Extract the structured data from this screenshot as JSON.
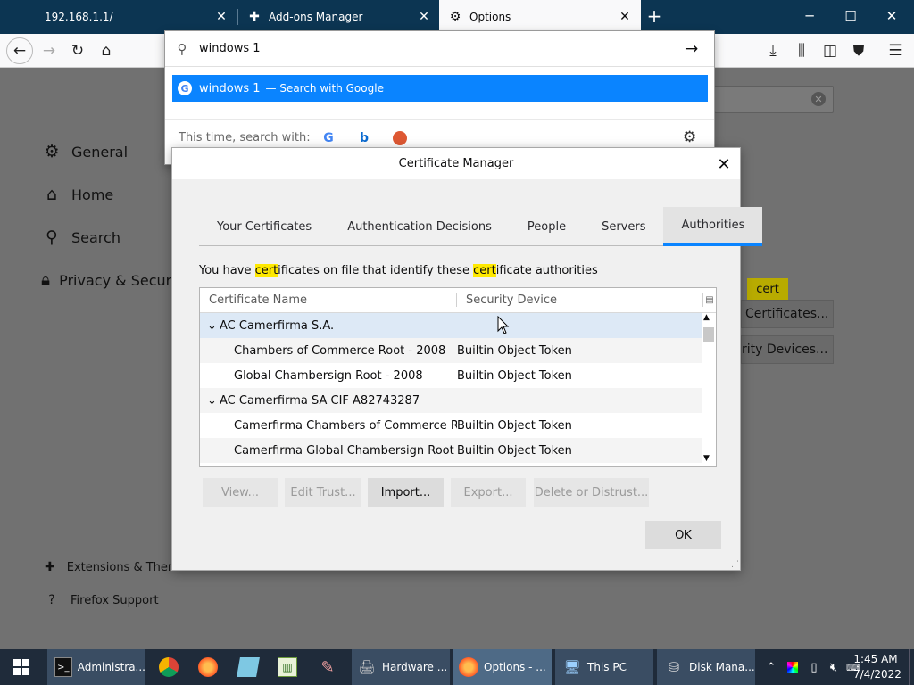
{
  "browser": {
    "tabs": [
      {
        "title": "192.168.1.1/",
        "icon": "page-icon"
      },
      {
        "title": "Add-ons Manager",
        "icon": "puzzle-icon"
      },
      {
        "title": "Options",
        "icon": "gear-icon",
        "active": true
      }
    ],
    "new_tab_glyph": "+",
    "window_controls": {
      "minimize": "─",
      "maximize": "☐",
      "close": "✕"
    }
  },
  "urlbar": {
    "value": "windows 1",
    "suggestion_text": "windows 1",
    "suggestion_action": "— Search with Google",
    "one_off_label": "This time, search with:",
    "engines": [
      "google-icon",
      "bing-icon",
      "duckduckgo-icon"
    ]
  },
  "prefs": {
    "categories": [
      {
        "label": "General",
        "icon": "gear-icon"
      },
      {
        "label": "Home",
        "icon": "home-icon"
      },
      {
        "label": "Search",
        "icon": "search-icon"
      },
      {
        "label": "Privacy & Security",
        "icon": "lock-icon"
      }
    ],
    "footer": [
      {
        "label": "Extensions & Themes",
        "icon": "puzzle-icon"
      },
      {
        "label": "Firefox Support",
        "icon": "help-icon"
      }
    ],
    "search_badge": "cert",
    "view_certificates_label": "Certificates...",
    "security_devices_label": "rity Devices..."
  },
  "dialog": {
    "title": "Certificate Manager",
    "tabs": [
      "Your Certificates",
      "Authentication Decisions",
      "People",
      "Servers",
      "Authorities"
    ],
    "selected_tab": "Authorities",
    "intro_pre": "You have ",
    "intro_hl1": "cert",
    "intro_mid": "ificates on file that identify these ",
    "intro_hl2": "cert",
    "intro_post": "ificate authorities",
    "columns": [
      "Certificate Name",
      "Security Device"
    ],
    "rows": [
      {
        "name": "AC Camerfirma S.A.",
        "device": "",
        "group": true
      },
      {
        "name": "Chambers of Commerce Root - 2008",
        "device": "Builtin Object Token",
        "group": false
      },
      {
        "name": "Global Chambersign Root - 2008",
        "device": "Builtin Object Token",
        "group": false
      },
      {
        "name": "AC Camerfirma SA CIF A82743287",
        "device": "",
        "group": true
      },
      {
        "name": "Camerfirma Chambers of Commerce Root",
        "device": "Builtin Object Token",
        "group": false
      },
      {
        "name": "Camerfirma Global Chambersign Root",
        "device": "Builtin Object Token",
        "group": false
      }
    ],
    "buttons": [
      {
        "label": "View...",
        "enabled": false
      },
      {
        "label": "Edit Trust...",
        "enabled": false
      },
      {
        "label": "Import...",
        "enabled": true
      },
      {
        "label": "Export...",
        "enabled": false
      },
      {
        "label": "Delete or Distrust...",
        "enabled": false
      }
    ],
    "ok_label": "OK"
  },
  "taskbar": {
    "items": [
      {
        "label": "Administra...",
        "icon": "terminal-icon"
      },
      {
        "label": "",
        "icon": "chrome-icon"
      },
      {
        "label": "",
        "icon": "firefox-icon"
      },
      {
        "label": "",
        "icon": "notepad-icon"
      },
      {
        "label": "",
        "icon": "spreadsheet-icon"
      },
      {
        "label": "",
        "icon": "paint-icon"
      },
      {
        "label": "Hardware ...",
        "icon": "hardware-icon"
      },
      {
        "label": "Options - ...",
        "icon": "firefox-icon"
      },
      {
        "label": "This PC",
        "icon": "computer-icon"
      },
      {
        "label": "Disk Mana...",
        "icon": "disk-icon"
      }
    ],
    "time": "1:45 AM",
    "date": "7/4/2022"
  },
  "colors": {
    "accent": "#0a84ff",
    "highlight": "#ffe900",
    "titlebar": "#0c3552",
    "taskbar": "#1f2b3a"
  }
}
